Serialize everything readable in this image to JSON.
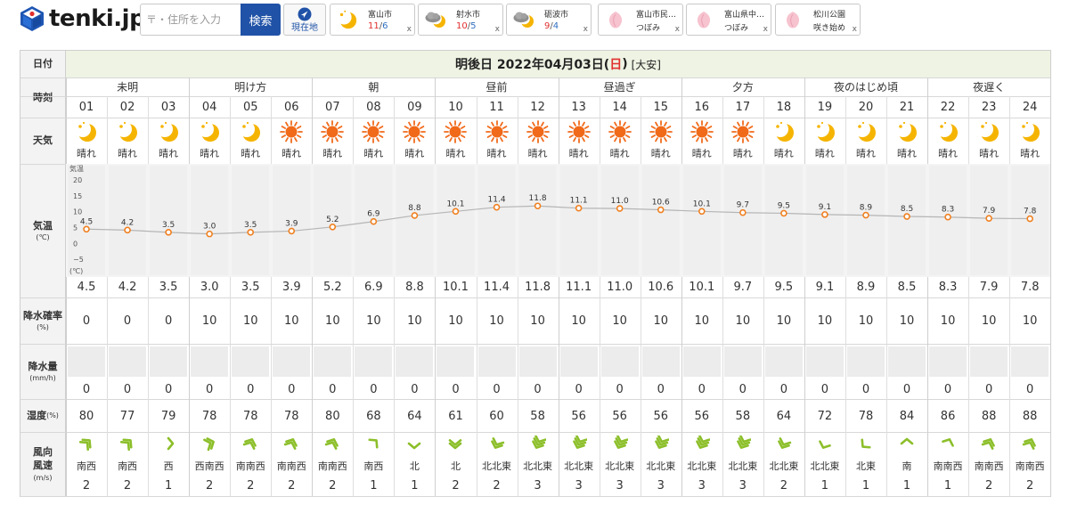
{
  "header": {
    "logo_text": "tenki.jp",
    "search_placeholder": "〒・住所を入力",
    "search_button": "検索",
    "location_button": "現在地",
    "favorites": [
      {
        "name": "富山市",
        "type": "moon",
        "hi": "11",
        "lo": "6",
        "close": "x"
      },
      {
        "name": "射水市",
        "type": "cloudmoon",
        "hi": "10",
        "lo": "5",
        "close": "x"
      },
      {
        "name": "砺波市",
        "type": "cloudmoon",
        "hi": "9",
        "lo": "4",
        "close": "x"
      },
      {
        "name": "富山市民…",
        "type": "sakura",
        "status": "つぼみ",
        "close": "x"
      },
      {
        "name": "富山県中…",
        "type": "sakura",
        "status": "つぼみ",
        "close": "x"
      },
      {
        "name": "松川公園",
        "type": "sakura",
        "status": "咲き始め",
        "close": "x"
      }
    ]
  },
  "colors": {
    "brand_blue": "#2052a7",
    "sunday_red": "#e0302e",
    "date_bg": "#eef3e3",
    "temp_dot": "#f08020",
    "wind_green": "#8cbf2a",
    "moon_yellow": "#f5b400",
    "sun_orange": "#f06a1a"
  },
  "table": {
    "labels": {
      "date": "日付",
      "time": "時刻",
      "weather": "天気",
      "temp": "気温",
      "temp_unit": "(℃)",
      "precip_prob": "降水確率",
      "precip_prob_unit": "(%)",
      "precip": "降水量",
      "precip_unit": "(mm/h)",
      "humidity": "湿度",
      "humidity_unit": "(%)",
      "wind_dir": "風向",
      "wind_speed": "風速",
      "wind_unit": "(m/s)"
    },
    "date_prefix": "明後日 2022年04月03日(",
    "date_day": "日",
    "date_suffix": ")",
    "rokuyo": "[大安]",
    "periods": [
      "未明",
      "明け方",
      "朝",
      "昼前",
      "昼過ぎ",
      "夕方",
      "夜のはじめ頃",
      "夜遅く"
    ],
    "hours": [
      "01",
      "02",
      "03",
      "04",
      "05",
      "06",
      "07",
      "08",
      "09",
      "10",
      "11",
      "12",
      "13",
      "14",
      "15",
      "16",
      "17",
      "18",
      "19",
      "20",
      "21",
      "22",
      "23",
      "24"
    ],
    "weather_icons": [
      "moon",
      "moon",
      "moon",
      "moon",
      "moon",
      "sun",
      "sun",
      "sun",
      "sun",
      "sun",
      "sun",
      "sun",
      "sun",
      "sun",
      "sun",
      "sun",
      "sun",
      "moon",
      "moon",
      "moon",
      "moon",
      "moon",
      "moon",
      "moon"
    ],
    "weather_text": [
      "晴れ",
      "晴れ",
      "晴れ",
      "晴れ",
      "晴れ",
      "晴れ",
      "晴れ",
      "晴れ",
      "晴れ",
      "晴れ",
      "晴れ",
      "晴れ",
      "晴れ",
      "晴れ",
      "晴れ",
      "晴れ",
      "晴れ",
      "晴れ",
      "晴れ",
      "晴れ",
      "晴れ",
      "晴れ",
      "晴れ",
      "晴れ"
    ],
    "temps": [
      4.5,
      4.2,
      3.5,
      3.0,
      3.5,
      3.9,
      5.2,
      6.9,
      8.8,
      10.1,
      11.4,
      11.8,
      11.1,
      11.0,
      10.6,
      10.1,
      9.7,
      9.5,
      9.1,
      8.9,
      8.5,
      8.3,
      7.9,
      7.8
    ],
    "temp_axis": {
      "ticks": [
        "20",
        "15",
        "10",
        "5",
        "0",
        "−5"
      ],
      "tick_values": [
        20,
        15,
        10,
        5,
        0,
        -5
      ],
      "top_label": "気温",
      "bottom_label": "(℃)",
      "ylim": [
        -10,
        20
      ]
    },
    "precip_prob": [
      "0",
      "0",
      "0",
      "10",
      "10",
      "10",
      "10",
      "10",
      "10",
      "10",
      "10",
      "10",
      "10",
      "10",
      "10",
      "10",
      "10",
      "10",
      "10",
      "10",
      "10",
      "10",
      "10",
      "10"
    ],
    "precip": [
      "0",
      "0",
      "0",
      "0",
      "0",
      "0",
      "0",
      "0",
      "0",
      "0",
      "0",
      "0",
      "0",
      "0",
      "0",
      "0",
      "0",
      "0",
      "0",
      "0",
      "0",
      "0",
      "0",
      "0"
    ],
    "humidity": [
      "80",
      "77",
      "79",
      "78",
      "78",
      "78",
      "80",
      "68",
      "64",
      "61",
      "60",
      "58",
      "56",
      "56",
      "56",
      "56",
      "58",
      "64",
      "72",
      "78",
      "84",
      "86",
      "88",
      "88"
    ],
    "wind_dir": [
      "南西",
      "南西",
      "西",
      "西南西",
      "南南西",
      "南南西",
      "南南西",
      "南西",
      "北",
      "北",
      "北北東",
      "北北東",
      "北北東",
      "北北東",
      "北北東",
      "北北東",
      "北北東",
      "北北東",
      "北北東",
      "北東",
      "南",
      "南南西",
      "南南西",
      "南南西"
    ],
    "wind_speed": [
      "2",
      "2",
      "1",
      "2",
      "2",
      "2",
      "2",
      "1",
      "1",
      "2",
      "2",
      "3",
      "3",
      "3",
      "3",
      "3",
      "3",
      "2",
      "1",
      "1",
      "1",
      "1",
      "2",
      "2"
    ]
  }
}
